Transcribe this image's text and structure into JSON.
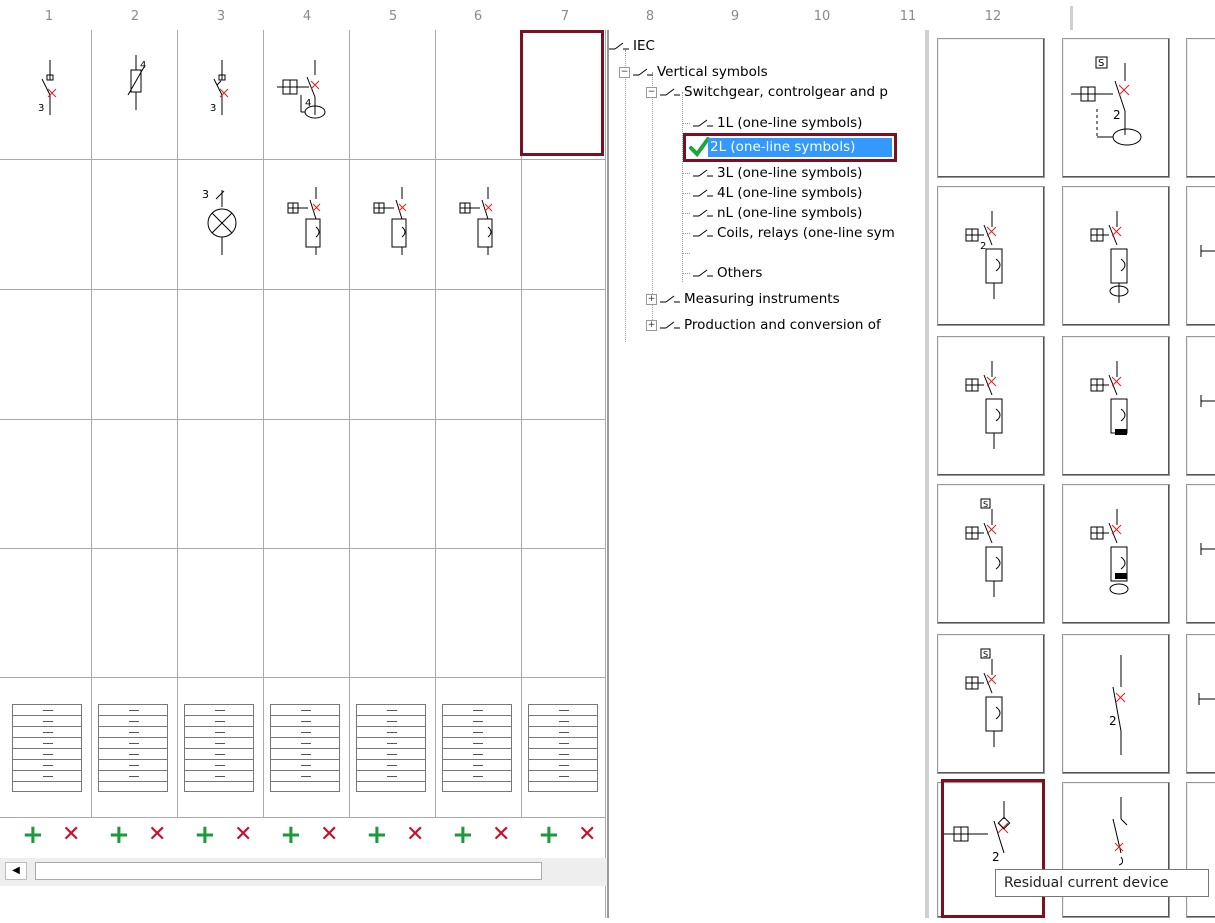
{
  "ruler": {
    "numbers": [
      "1",
      "2",
      "3",
      "4",
      "5",
      "6",
      "7",
      "8",
      "9",
      "10",
      "11",
      "12"
    ]
  },
  "tree": {
    "root": "IEC",
    "vertical": "Vertical symbols",
    "switchgear": "Switchgear, controlgear and p",
    "items": [
      "1L (one-line symbols)",
      "2L (one-line symbols)",
      "3L (one-line symbols)",
      "4L (one-line symbols)",
      "nL (one-line symbols)",
      "Coils, relays (one-line sym",
      "Others"
    ],
    "measuring": "Measuring instruments",
    "production": "Production and conversion of"
  },
  "controls": {
    "add": "+",
    "remove": "✕"
  },
  "tooltip": "Residual current device",
  "labels": {
    "rcd_num": "2",
    "three": "3",
    "four": "4",
    "s": "S"
  },
  "colors": {
    "selection": "#7b1020",
    "add": "#1a9a3a",
    "remove": "#c8102e",
    "highlight": "#3399ff"
  }
}
